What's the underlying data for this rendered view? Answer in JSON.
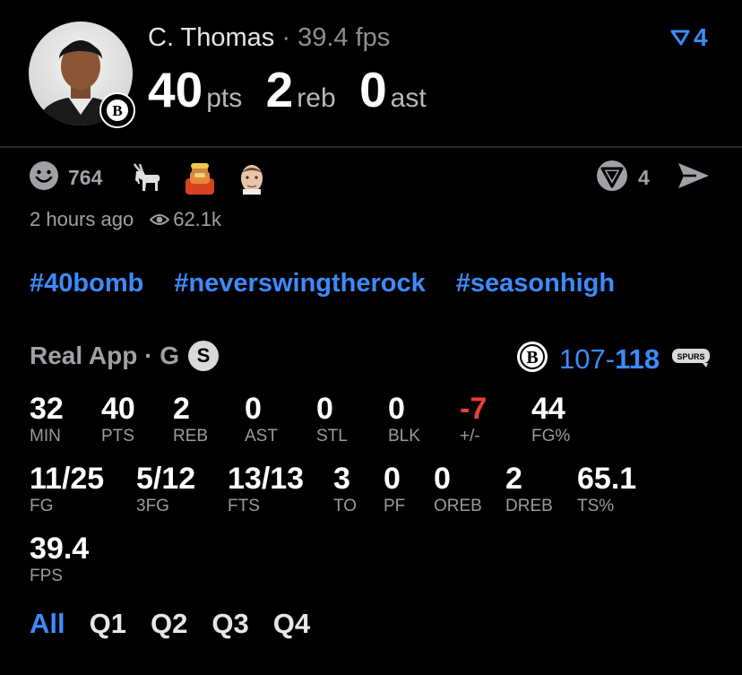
{
  "player": {
    "name": "C. Thomas",
    "separator": " · ",
    "fps_label": "39.4 fps",
    "pts_value": "40",
    "pts_unit": "pts",
    "reb_value": "2",
    "reb_unit": "reb",
    "ast_value": "0",
    "ast_unit": "ast"
  },
  "header": {
    "filter_count": "4"
  },
  "reactions": {
    "count": "764",
    "emojis": [
      "goat-icon",
      "hulk-hogan-emoji",
      "jokic-emoji"
    ],
    "comment_count": "4"
  },
  "post": {
    "time_ago": "2 hours ago",
    "views": "62.1k"
  },
  "hashtags": [
    "#40bomb",
    "#neverswingtherock",
    "#seasonhigh"
  ],
  "game": {
    "source_label": "Real App · G",
    "badge_letter": "S",
    "score_home": "107",
    "score_dash": "-",
    "score_away": "118",
    "home_team_icon": "nets-logo-icon",
    "away_team_icon": "spurs-logo-icon"
  },
  "stats": {
    "row1": [
      {
        "value": "32",
        "label": "MIN"
      },
      {
        "value": "40",
        "label": "PTS"
      },
      {
        "value": "2",
        "label": "REB"
      },
      {
        "value": "0",
        "label": "AST"
      },
      {
        "value": "0",
        "label": "STL"
      },
      {
        "value": "0",
        "label": "BLK"
      },
      {
        "value": "-7",
        "label": "+/-"
      },
      {
        "value": "44",
        "label": "FG%"
      }
    ],
    "row2": [
      {
        "value": "11/25",
        "label": "FG"
      },
      {
        "value": "5/12",
        "label": "3FG"
      },
      {
        "value": "13/13",
        "label": "FTS"
      },
      {
        "value": "3",
        "label": "TO"
      },
      {
        "value": "0",
        "label": "PF"
      },
      {
        "value": "0",
        "label": "OREB"
      },
      {
        "value": "2",
        "label": "DREB"
      },
      {
        "value": "65.1",
        "label": "TS%"
      }
    ],
    "row3": [
      {
        "value": "39.4",
        "label": "FPS"
      }
    ]
  },
  "quarter_tabs": [
    "All",
    "Q1",
    "Q2",
    "Q3",
    "Q4"
  ],
  "colors": {
    "accent": "#3d8bfd",
    "negative": "#e5413a",
    "muted": "#a0a0a5"
  }
}
